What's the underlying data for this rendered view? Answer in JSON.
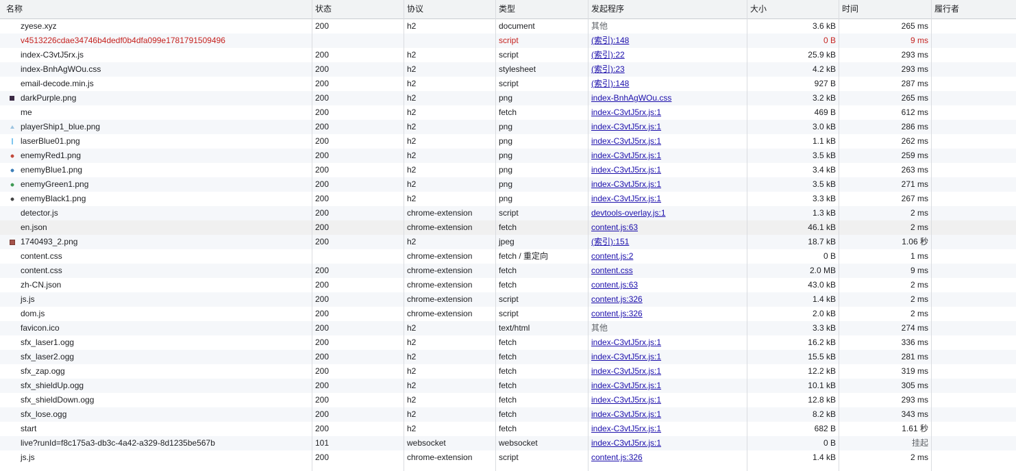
{
  "columns": {
    "name": "名称",
    "status": "状态",
    "protocol": "协议",
    "type": "类型",
    "initiator": "发起程序",
    "size": "大小",
    "time": "时间",
    "waterfall": "履行者"
  },
  "rows": [
    {
      "name": "zyese.xyz",
      "status": "200",
      "protocol": "h2",
      "type": "document",
      "initiator": "其他",
      "initiator_kind": "other",
      "size": "3.6 kB",
      "time": "265 ms",
      "icon": "none"
    },
    {
      "name": "v4513226cdae34746b4dedf0b4dfa099e1781791509496",
      "status": "",
      "protocol": "",
      "type": "script",
      "initiator": "(索引):148",
      "initiator_kind": "link",
      "size": "0 B",
      "time": "9 ms",
      "icon": "none",
      "error": true
    },
    {
      "name": "index-C3vtJ5rx.js",
      "status": "200",
      "protocol": "h2",
      "type": "script",
      "initiator": "(索引):22",
      "initiator_kind": "link",
      "size": "25.9 kB",
      "time": "293 ms",
      "icon": "none"
    },
    {
      "name": "index-BnhAgWOu.css",
      "status": "200",
      "protocol": "h2",
      "type": "stylesheet",
      "initiator": "(索引):23",
      "initiator_kind": "link",
      "size": "4.2 kB",
      "time": "293 ms",
      "icon": "none"
    },
    {
      "name": "email-decode.min.js",
      "status": "200",
      "protocol": "h2",
      "type": "script",
      "initiator": "(索引):148",
      "initiator_kind": "link",
      "size": "927 B",
      "time": "287 ms",
      "icon": "none"
    },
    {
      "name": "darkPurple.png",
      "status": "200",
      "protocol": "h2",
      "type": "png",
      "initiator": "index-BnhAgWOu.css",
      "initiator_kind": "link",
      "size": "3.2 kB",
      "time": "265 ms",
      "icon": "ic-dark"
    },
    {
      "name": "me",
      "status": "200",
      "protocol": "h2",
      "type": "fetch",
      "initiator": "index-C3vtJ5rx.js:1",
      "initiator_kind": "link",
      "size": "469 B",
      "time": "612 ms",
      "icon": "none"
    },
    {
      "name": "playerShip1_blue.png",
      "status": "200",
      "protocol": "h2",
      "type": "png",
      "initiator": "index-C3vtJ5rx.js:1",
      "initiator_kind": "link",
      "size": "3.0 kB",
      "time": "286 ms",
      "icon": "ic-ship"
    },
    {
      "name": "laserBlue01.png",
      "status": "200",
      "protocol": "h2",
      "type": "png",
      "initiator": "index-C3vtJ5rx.js:1",
      "initiator_kind": "link",
      "size": "1.1 kB",
      "time": "262 ms",
      "icon": "ic-laser"
    },
    {
      "name": "enemyRed1.png",
      "status": "200",
      "protocol": "h2",
      "type": "png",
      "initiator": "index-C3vtJ5rx.js:1",
      "initiator_kind": "link",
      "size": "3.5 kB",
      "time": "259 ms",
      "icon": "ic-red"
    },
    {
      "name": "enemyBlue1.png",
      "status": "200",
      "protocol": "h2",
      "type": "png",
      "initiator": "index-C3vtJ5rx.js:1",
      "initiator_kind": "link",
      "size": "3.4 kB",
      "time": "263 ms",
      "icon": "ic-blue"
    },
    {
      "name": "enemyGreen1.png",
      "status": "200",
      "protocol": "h2",
      "type": "png",
      "initiator": "index-C3vtJ5rx.js:1",
      "initiator_kind": "link",
      "size": "3.5 kB",
      "time": "271 ms",
      "icon": "ic-green"
    },
    {
      "name": "enemyBlack1.png",
      "status": "200",
      "protocol": "h2",
      "type": "png",
      "initiator": "index-C3vtJ5rx.js:1",
      "initiator_kind": "link",
      "size": "3.3 kB",
      "time": "267 ms",
      "icon": "ic-black"
    },
    {
      "name": "detector.js",
      "status": "200",
      "protocol": "chrome-extension",
      "type": "script",
      "initiator": "devtools-overlay.js:1",
      "initiator_kind": "link",
      "size": "1.3 kB",
      "time": "2 ms",
      "icon": "none"
    },
    {
      "name": "en.json",
      "status": "200",
      "protocol": "chrome-extension",
      "type": "fetch",
      "initiator": "content.js:63",
      "initiator_kind": "link",
      "size": "46.1 kB",
      "time": "2 ms",
      "icon": "none",
      "highlight": true
    },
    {
      "name": "1740493_2.png",
      "status": "200",
      "protocol": "h2",
      "type": "jpeg",
      "initiator": "(索引):151",
      "initiator_kind": "link",
      "size": "18.7 kB",
      "time": "1.06 秒",
      "icon": "ic-img"
    },
    {
      "name": "content.css",
      "status": "",
      "protocol": "chrome-extension",
      "type": "fetch / 重定向",
      "initiator": "content.js:2",
      "initiator_kind": "link",
      "size": "0 B",
      "time": "1 ms",
      "icon": "none"
    },
    {
      "name": "content.css",
      "status": "200",
      "protocol": "chrome-extension",
      "type": "fetch",
      "initiator": "content.css",
      "initiator_kind": "link",
      "size": "2.0 MB",
      "time": "9 ms",
      "icon": "none"
    },
    {
      "name": "zh-CN.json",
      "status": "200",
      "protocol": "chrome-extension",
      "type": "fetch",
      "initiator": "content.js:63",
      "initiator_kind": "link",
      "size": "43.0 kB",
      "time": "2 ms",
      "icon": "none"
    },
    {
      "name": "js.js",
      "status": "200",
      "protocol": "chrome-extension",
      "type": "script",
      "initiator": "content.js:326",
      "initiator_kind": "link",
      "size": "1.4 kB",
      "time": "2 ms",
      "icon": "none"
    },
    {
      "name": "dom.js",
      "status": "200",
      "protocol": "chrome-extension",
      "type": "script",
      "initiator": "content.js:326",
      "initiator_kind": "link",
      "size": "2.0 kB",
      "time": "2 ms",
      "icon": "none"
    },
    {
      "name": "favicon.ico",
      "status": "200",
      "protocol": "h2",
      "type": "text/html",
      "initiator": "其他",
      "initiator_kind": "other",
      "size": "3.3 kB",
      "time": "274 ms",
      "icon": "none"
    },
    {
      "name": "sfx_laser1.ogg",
      "status": "200",
      "protocol": "h2",
      "type": "fetch",
      "initiator": "index-C3vtJ5rx.js:1",
      "initiator_kind": "link",
      "size": "16.2 kB",
      "time": "336 ms",
      "icon": "none"
    },
    {
      "name": "sfx_laser2.ogg",
      "status": "200",
      "protocol": "h2",
      "type": "fetch",
      "initiator": "index-C3vtJ5rx.js:1",
      "initiator_kind": "link",
      "size": "15.5 kB",
      "time": "281 ms",
      "icon": "none"
    },
    {
      "name": "sfx_zap.ogg",
      "status": "200",
      "protocol": "h2",
      "type": "fetch",
      "initiator": "index-C3vtJ5rx.js:1",
      "initiator_kind": "link",
      "size": "12.2 kB",
      "time": "319 ms",
      "icon": "none"
    },
    {
      "name": "sfx_shieldUp.ogg",
      "status": "200",
      "protocol": "h2",
      "type": "fetch",
      "initiator": "index-C3vtJ5rx.js:1",
      "initiator_kind": "link",
      "size": "10.1 kB",
      "time": "305 ms",
      "icon": "none"
    },
    {
      "name": "sfx_shieldDown.ogg",
      "status": "200",
      "protocol": "h2",
      "type": "fetch",
      "initiator": "index-C3vtJ5rx.js:1",
      "initiator_kind": "link",
      "size": "12.8 kB",
      "time": "293 ms",
      "icon": "none"
    },
    {
      "name": "sfx_lose.ogg",
      "status": "200",
      "protocol": "h2",
      "type": "fetch",
      "initiator": "index-C3vtJ5rx.js:1",
      "initiator_kind": "link",
      "size": "8.2 kB",
      "time": "343 ms",
      "icon": "none"
    },
    {
      "name": "start",
      "status": "200",
      "protocol": "h2",
      "type": "fetch",
      "initiator": "index-C3vtJ5rx.js:1",
      "initiator_kind": "link",
      "size": "682 B",
      "time": "1.61 秒",
      "icon": "none"
    },
    {
      "name": "live?runId=f8c175a3-db3c-4a42-a329-8d1235be567b",
      "status": "101",
      "protocol": "websocket",
      "type": "websocket",
      "initiator": "index-C3vtJ5rx.js:1",
      "initiator_kind": "link",
      "size": "0 B",
      "time": "挂起",
      "time_kind": "other",
      "icon": "none"
    },
    {
      "name": "js.js",
      "status": "200",
      "protocol": "chrome-extension",
      "type": "script",
      "initiator": "content.js:326",
      "initiator_kind": "link",
      "size": "1.4 kB",
      "time": "2 ms",
      "icon": "none"
    }
  ]
}
